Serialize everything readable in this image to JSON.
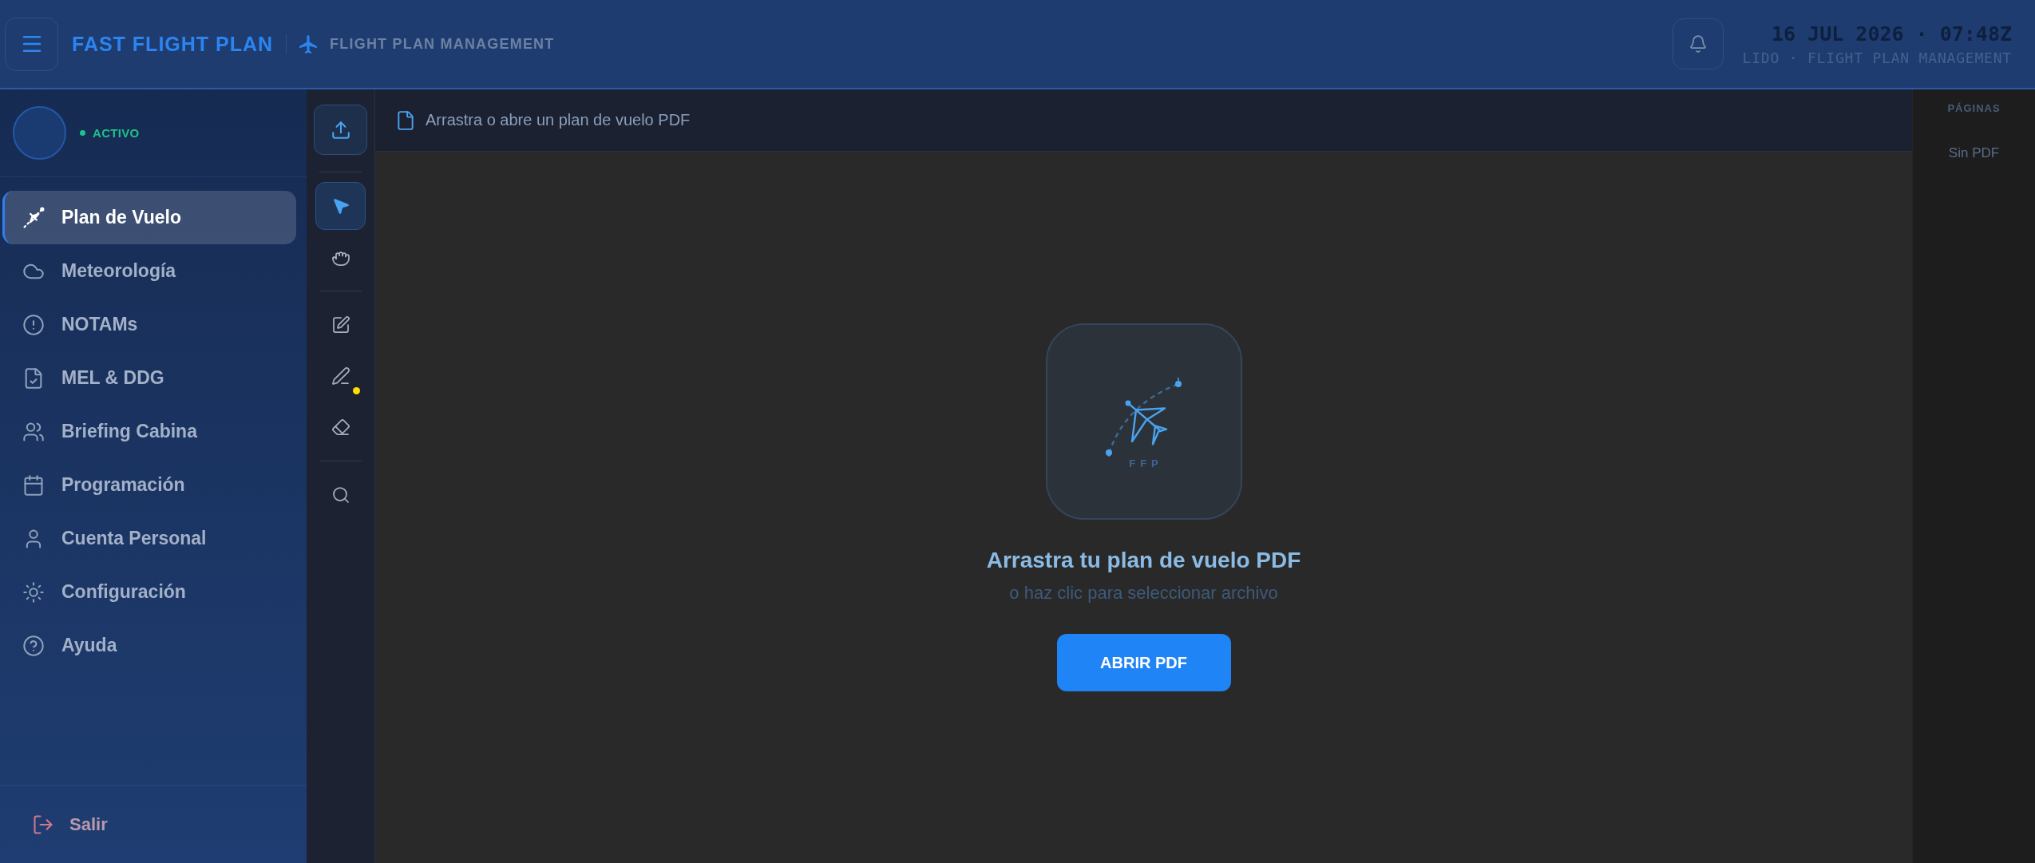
{
  "header": {
    "title": "FAST FLIGHT PLAN",
    "subtitle": "FLIGHT PLAN MANAGEMENT",
    "datetime": "16 JUL 2026 · 07:48Z",
    "system": "LIDO · FLIGHT PLAN MANAGEMENT"
  },
  "profile": {
    "status": "ACTIVO",
    "active": true
  },
  "sidebar": {
    "items": [
      {
        "label": "Plan de Vuelo",
        "selected": true
      },
      {
        "label": "Meteorología",
        "selected": false
      },
      {
        "label": "NOTAMs",
        "selected": false
      },
      {
        "label": "MEL & DDG",
        "selected": false
      },
      {
        "label": "Briefing Cabina",
        "selected": false
      },
      {
        "label": "Programación",
        "selected": false
      },
      {
        "label": "Cuenta Personal",
        "selected": false
      },
      {
        "label": "Configuración",
        "selected": false
      },
      {
        "label": "Ayuda",
        "selected": false
      }
    ],
    "logout": "Salir"
  },
  "toolbar": {
    "groups": [
      {
        "tools": [
          {
            "kind": "select",
            "selected": true
          },
          {
            "kind": "hand",
            "selected": false
          }
        ]
      },
      {
        "tools": [
          {
            "kind": "annotate",
            "selected": false
          },
          {
            "kind": "pen",
            "selected": false,
            "color": "#ffdd00"
          },
          {
            "kind": "eraser",
            "selected": false
          }
        ]
      },
      {
        "tools": [
          {
            "kind": "search",
            "selected": false
          }
        ]
      }
    ]
  },
  "document": {
    "hint": "Arrastra o abre un plan de vuelo PDF"
  },
  "dropzone": {
    "logo_text": "FFP",
    "title": "Arrastra tu plan de vuelo PDF",
    "subtitle": "o haz clic para seleccionar archivo",
    "button": "ABRIR PDF"
  },
  "pages_panel": {
    "title": "PÁGINAS",
    "empty_text": "Sin PDF"
  }
}
